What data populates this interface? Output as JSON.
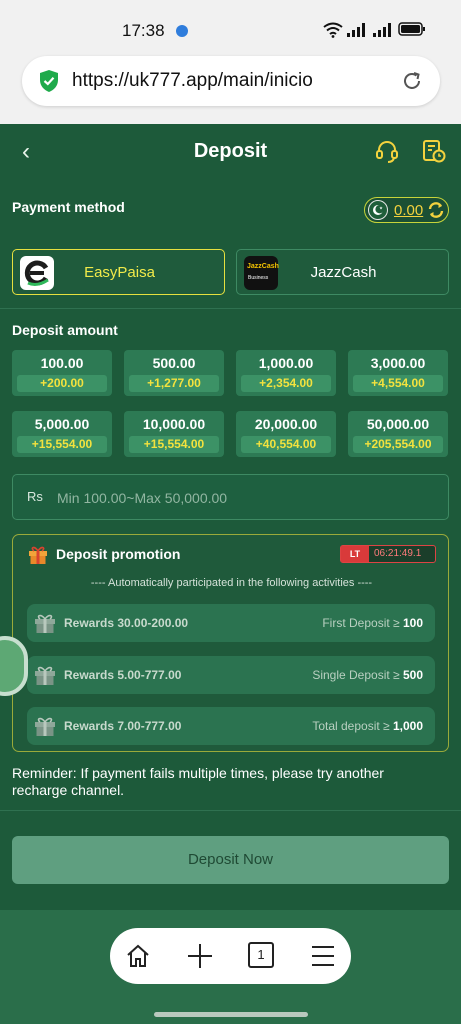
{
  "status_bar": {
    "time": "17:38"
  },
  "browser": {
    "url": "https://uk777.app/main/inicio",
    "tab_count": "1"
  },
  "header": {
    "title": "Deposit"
  },
  "payment": {
    "label": "Payment method",
    "balance": "0.00",
    "methods": [
      {
        "name": "EasyPaisa",
        "selected": true
      },
      {
        "name": "JazzCash",
        "selected": false,
        "logo_text": "JazzCash",
        "logo_sub": "Business"
      }
    ]
  },
  "deposit": {
    "label": "Deposit amount",
    "amounts": [
      {
        "value": "100.00",
        "bonus": "+200.00"
      },
      {
        "value": "500.00",
        "bonus": "+1,277.00"
      },
      {
        "value": "1,000.00",
        "bonus": "+2,354.00"
      },
      {
        "value": "3,000.00",
        "bonus": "+4,554.00"
      },
      {
        "value": "5,000.00",
        "bonus": "+15,554.00"
      },
      {
        "value": "10,000.00",
        "bonus": "+15,554.00"
      },
      {
        "value": "20,000.00",
        "bonus": "+40,554.00"
      },
      {
        "value": "50,000.00",
        "bonus": "+205,554.00"
      }
    ],
    "currency": "Rs",
    "placeholder": "Min 100.00~Max 50,000.00"
  },
  "promotion": {
    "title": "Deposit promotion",
    "badge": "LT",
    "countdown": "06:21:49.1",
    "subtitle": "---- Automatically participated in the following activities ----",
    "rewards": [
      {
        "label": "Rewards 30.00-200.00",
        "condition": "First Deposit ≥",
        "threshold": "100"
      },
      {
        "label": "Rewards 5.00-777.00",
        "condition": "Single Deposit ≥",
        "threshold": "500"
      },
      {
        "label": "Rewards 7.00-777.00",
        "condition": "Total deposit ≥",
        "threshold": "1,000"
      }
    ]
  },
  "reminder": "Reminder: If payment fails multiple times, please try another recharge channel.",
  "deposit_button": "Deposit Now",
  "colors": {
    "accent": "#f3d23e",
    "brand_green": "#1d5a3a",
    "bonus_text": "#f3e23e"
  }
}
